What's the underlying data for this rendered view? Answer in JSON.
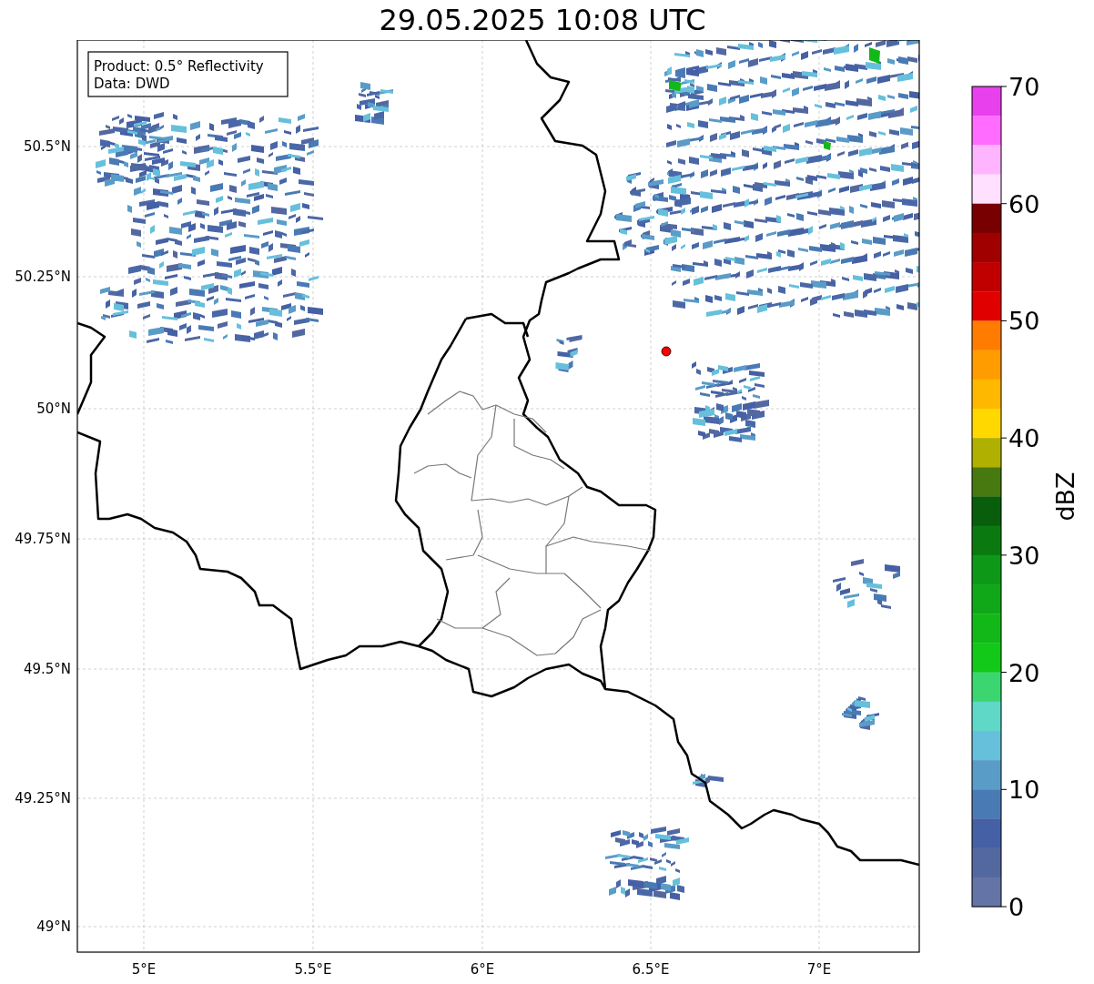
{
  "title": "29.05.2025 10:08 UTC",
  "info_box": {
    "lines": [
      "Product: 0.5° Reflectivity",
      "Data: DWD"
    ]
  },
  "map": {
    "x_ticks": [
      "5°E",
      "5.5°E",
      "6°E",
      "6.5°E",
      "7°E"
    ],
    "y_ticks": [
      "50.5°N",
      "50.25°N",
      "50°N",
      "49.75°N",
      "49.5°N",
      "49.25°N",
      "49°N"
    ]
  },
  "colorbar": {
    "label": "dBZ",
    "ticks": [
      "70",
      "60",
      "50",
      "40",
      "30",
      "20",
      "10",
      "0"
    ],
    "bins": [
      {
        "color": "#e840ec"
      },
      {
        "color": "#ff6cff"
      },
      {
        "color": "#ffb4ff"
      },
      {
        "color": "#ffe0ff"
      },
      {
        "color": "#780000"
      },
      {
        "color": "#a00000"
      },
      {
        "color": "#c00000"
      },
      {
        "color": "#e00000"
      },
      {
        "color": "#ff7c00"
      },
      {
        "color": "#ff9c00"
      },
      {
        "color": "#ffb800"
      },
      {
        "color": "#ffd800"
      },
      {
        "color": "#b0b000"
      },
      {
        "color": "#487810"
      },
      {
        "color": "#085e0c"
      },
      {
        "color": "#0a7a10"
      },
      {
        "color": "#0e9818"
      },
      {
        "color": "#10a818"
      },
      {
        "color": "#12b818"
      },
      {
        "color": "#12c818"
      },
      {
        "color": "#3cd670"
      },
      {
        "color": "#60d8c8"
      },
      {
        "color": "#66c0dc"
      },
      {
        "color": "#5a9cc8"
      },
      {
        "color": "#4a7ab4"
      },
      {
        "color": "#4560a4"
      },
      {
        "color": "#5468a0"
      },
      {
        "color": "#6574a6"
      }
    ]
  }
}
